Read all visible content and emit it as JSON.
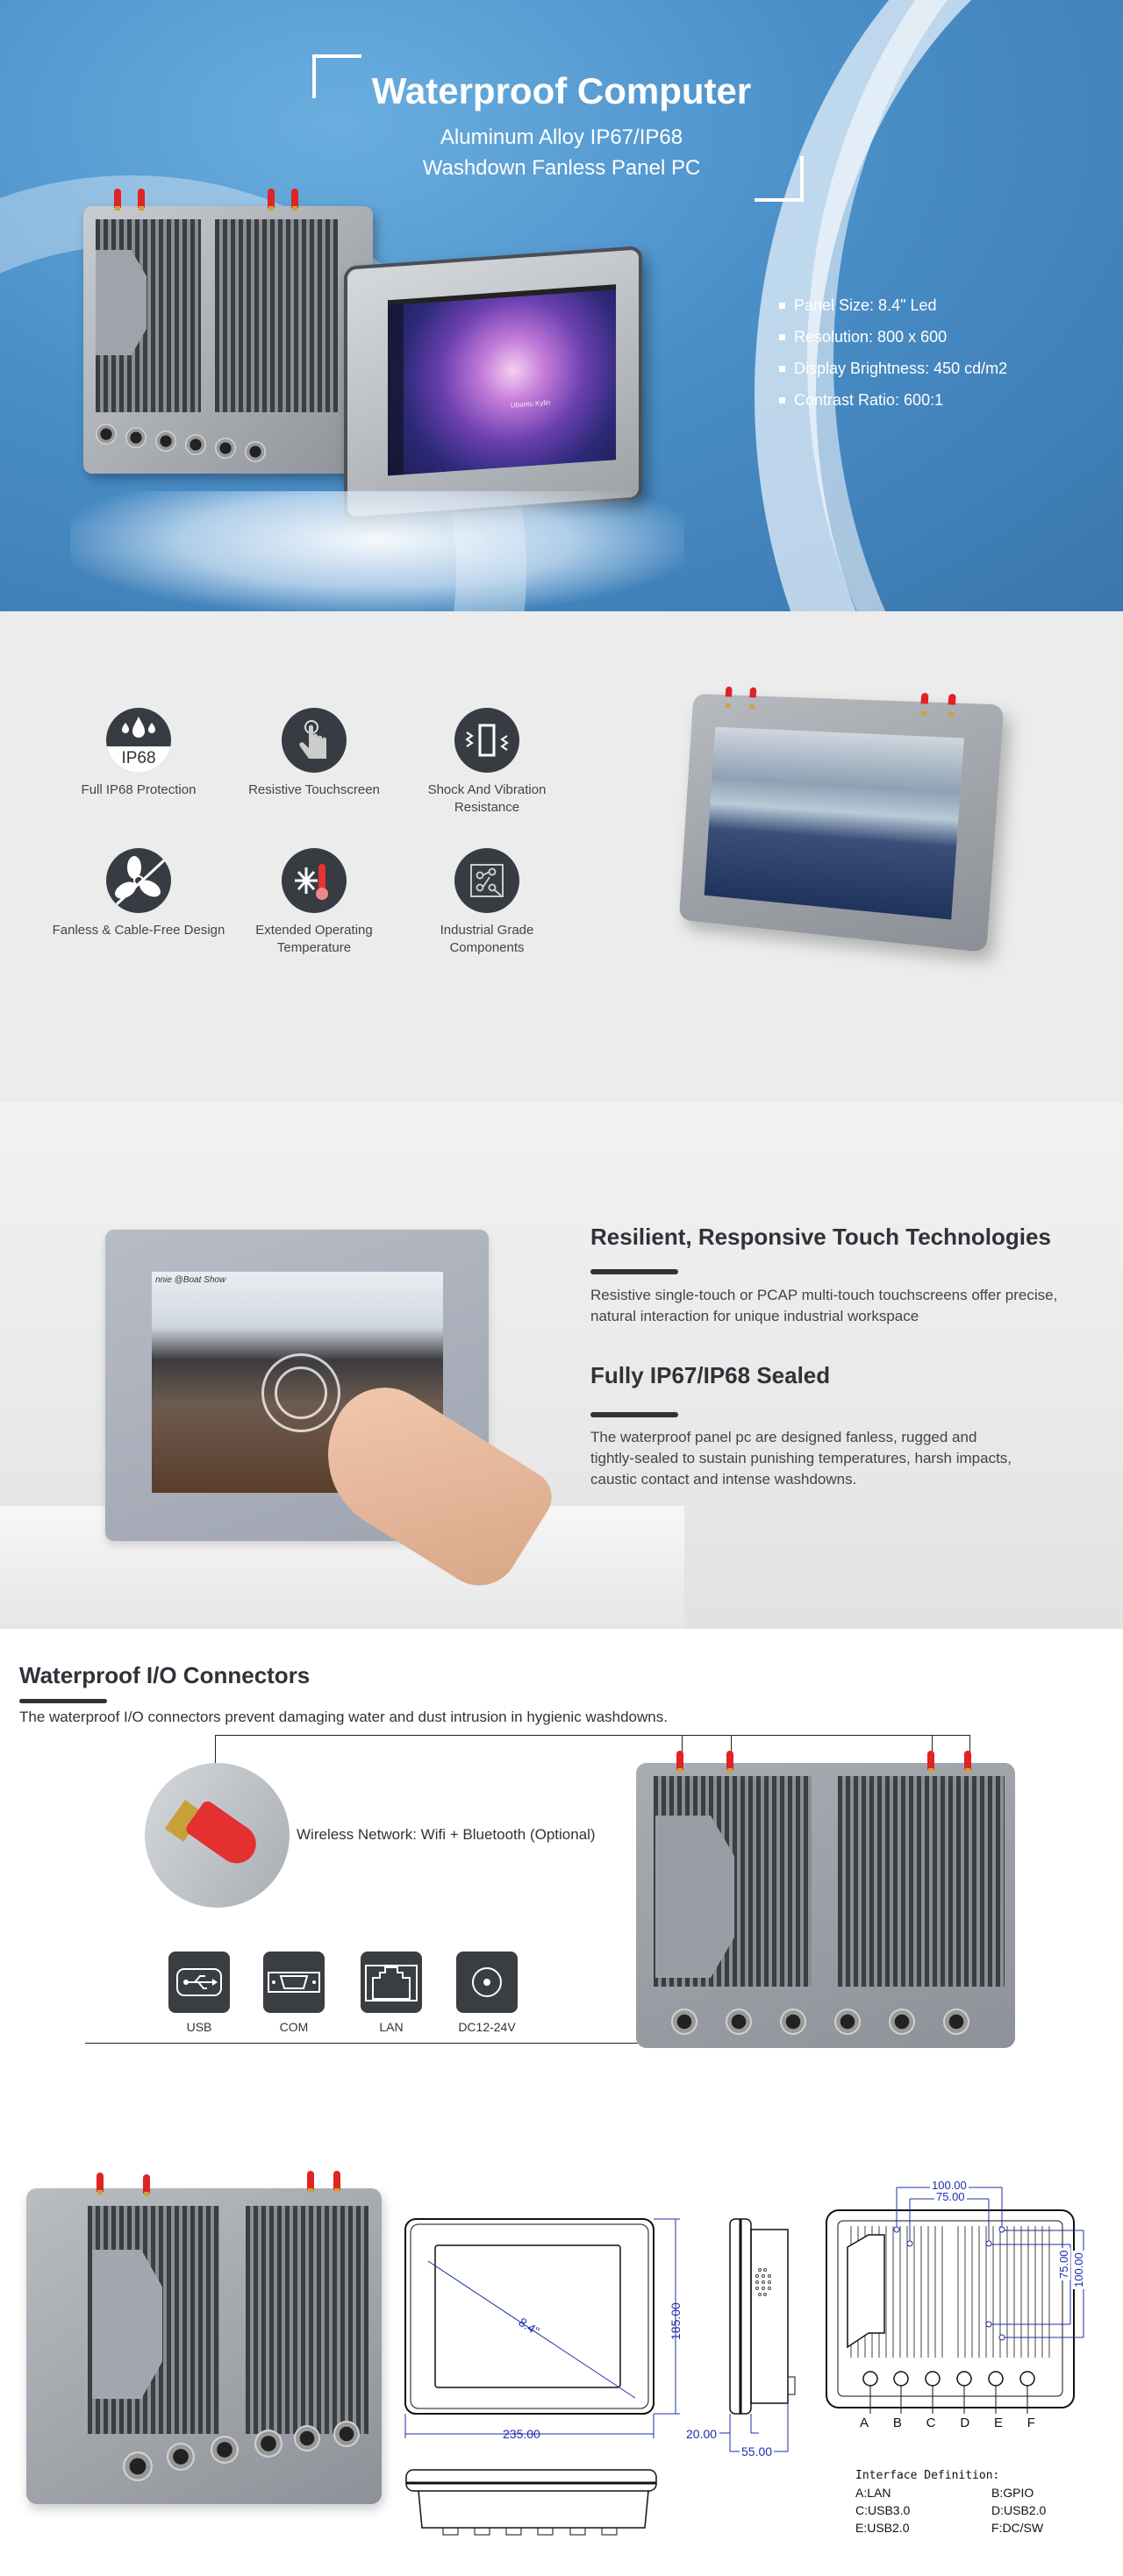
{
  "hero": {
    "title": "Waterproof Computer",
    "subtitle_line1": "Aluminum Alloy IP67/IP68",
    "subtitle_line2": "Washdown Fanless Panel PC",
    "specs": [
      "Panel Size: 8.4\" Led",
      "Resolution: 800 x 600",
      "Display Brightness: 450 cd/m2",
      "Contrast Ratio: 600:1"
    ],
    "screen_brand": "Ubuntu Kylin"
  },
  "features": {
    "items": [
      {
        "label_line1": "Full IP68 Protection",
        "label_line2": "",
        "icon": "ip68-water-drops-icon",
        "badge": "IP68"
      },
      {
        "label_line1": "Resistive Touchscreen",
        "label_line2": "",
        "icon": "touch-finger-icon"
      },
      {
        "label_line1": "Shock And Vibration",
        "label_line2": "Resistance",
        "icon": "vibration-icon"
      },
      {
        "label_line1": "Fanless & Cable-Free Design",
        "label_line2": "",
        "icon": "fanless-icon"
      },
      {
        "label_line1": "Extended Operating",
        "label_line2": "Temperature",
        "icon": "temperature-icon"
      },
      {
        "label_line1": "Industrial Grade",
        "label_line2": "Components",
        "icon": "circuit-board-icon"
      }
    ]
  },
  "touch": {
    "heading1": "Resilient, Responsive Touch Technologies",
    "para1_line1": "Resistive single-touch or PCAP multi-touch touchscreens offer precise,",
    "para1_line2": "natural interaction for unique industrial workspace",
    "heading2": "Fully IP67/IP68 Sealed",
    "para2_line1": "The waterproof panel pc are designed fanless, rugged and",
    "para2_line2": "tightly-sealed to sustain punishing temperatures, harsh impacts,",
    "para2_line3": "caustic contact and intense washdowns.",
    "screen_caption": "nnie @Boat Show"
  },
  "io": {
    "title": "Waterproof I/O Connectors",
    "description": "The waterproof I/O connectors prevent damaging water and dust intrusion in hygienic washdowns.",
    "wireless_label": "Wireless Network: Wifi + Bluetooth (Optional)",
    "ports": [
      {
        "label": "USB",
        "icon": "usb-icon"
      },
      {
        "label": "COM",
        "icon": "serial-port-icon"
      },
      {
        "label": "LAN",
        "icon": "ethernet-port-icon"
      },
      {
        "label": "DC12-24V",
        "icon": "dc-power-icon"
      }
    ]
  },
  "drawings": {
    "front_width": "235.00",
    "front_height": "185.00",
    "diagonal": "8.4\"",
    "side_front_depth": "20.00",
    "side_total_depth": "55.00",
    "vesa_outer": "100.00",
    "vesa_inner": "75.00",
    "vesa_outer_v": "100.00",
    "vesa_inner_v": "75.00",
    "connector_letters": [
      "A",
      "B",
      "C",
      "D",
      "E",
      "F"
    ],
    "interface_title": "Interface Definition:",
    "interface_rows": [
      {
        "left": "A:LAN",
        "right": "B:GPIO"
      },
      {
        "left": "C:USB3.0",
        "right": "D:USB2.0"
      },
      {
        "left": "E:USB2.0",
        "right": "F:DC/SW"
      }
    ]
  },
  "colors": {
    "hero_blue": "#4a8fc8",
    "dark_icon": "#373b42",
    "antenna_red": "#e02323",
    "dimension_blue": "#1c2fa8"
  }
}
